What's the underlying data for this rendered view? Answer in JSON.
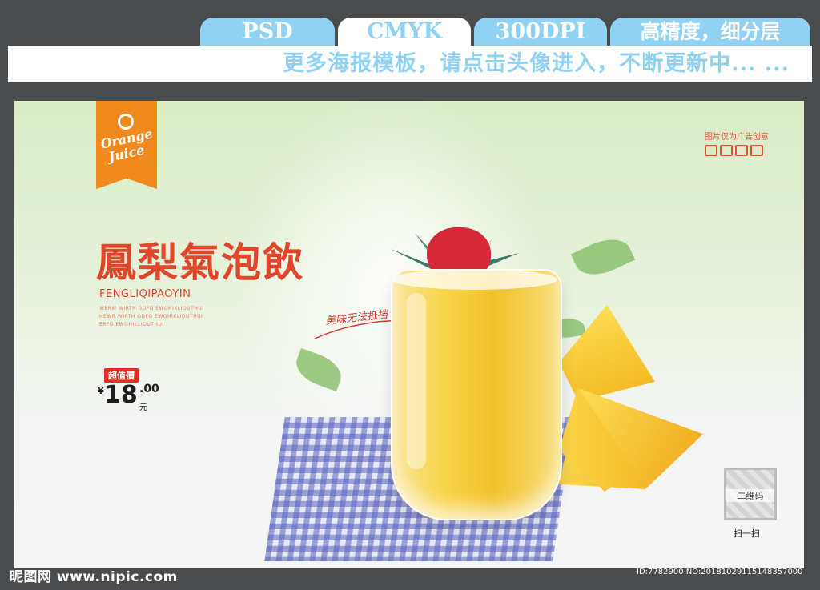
{
  "header": {
    "tabs": [
      "PSD",
      "CMYK",
      "300DPI",
      "高精度，细分层"
    ],
    "banner": "更多海报模板，请点击头像进入，不断更新中... ..."
  },
  "poster": {
    "logo": {
      "line1": "Orange",
      "line2": "Juice"
    },
    "disclaimer": "图片仅为广告创意",
    "title": "鳳梨氣泡飲",
    "subtitle": "FENGLIQIPAOYIN",
    "small_text": [
      "WERW WIRTH GDFG EWGHIKLIOUTHUI",
      "HEWR WIRTH GDFG EWGHIKLIOUTHUI",
      "ERFG EWGHIKLIOUTHUI"
    ],
    "badge": "超值價",
    "currency": "¥",
    "price": "18",
    "cents": ".00",
    "unit": "元",
    "tagline": "美味无法抵挡",
    "qr_label": "二维码",
    "scan_label": "扫一扫"
  },
  "footer": {
    "watermark": "昵图网 www.nipic.com",
    "id_line": "ID:7782900 NO:20181029115148357000"
  },
  "colors": {
    "accent_blue": "#8fd2f4",
    "title_red": "#e0472a",
    "ribbon_orange": "#f08a1e",
    "frame": "#4a4b4d"
  }
}
